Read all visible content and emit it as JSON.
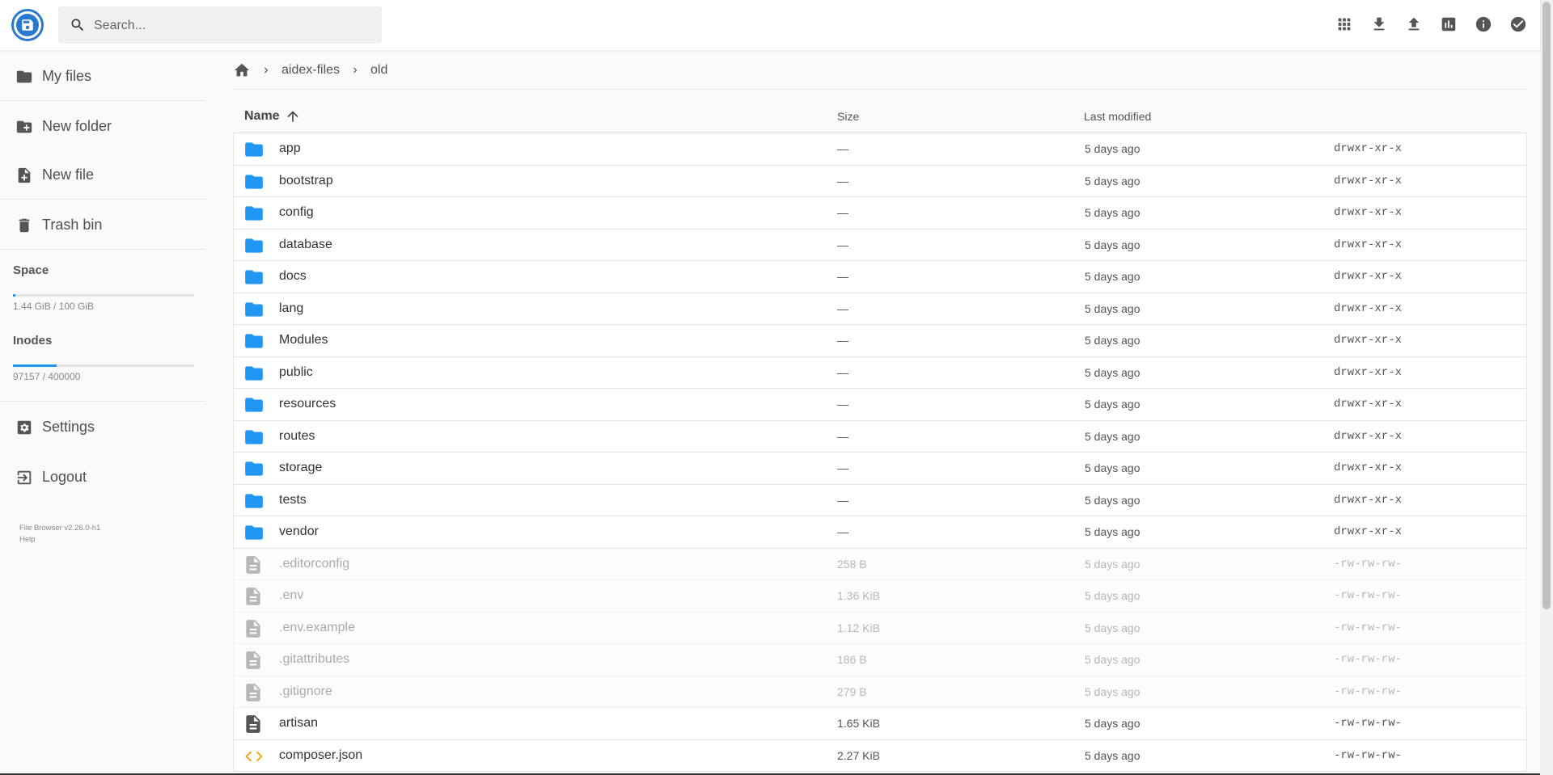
{
  "header": {
    "search_placeholder": "Search...",
    "actions": [
      "grid-view-icon",
      "download-icon",
      "upload-icon",
      "chart-icon",
      "info-icon",
      "select-check-icon"
    ]
  },
  "sidebar": {
    "items": [
      {
        "label": "My files",
        "icon": "folder-icon"
      },
      {
        "label": "New folder",
        "icon": "create-new-folder-icon"
      },
      {
        "label": "New file",
        "icon": "note-add-icon"
      },
      {
        "label": "Trash bin",
        "icon": "trash-icon"
      }
    ],
    "quota": {
      "space_title": "Space",
      "space_text": "1.44 GiB / 100 GiB",
      "space_fraction": 0.0144,
      "inodes_title": "Inodes",
      "inodes_text": "97157 / 400000",
      "inodes_fraction": 0.243
    },
    "settings_label": "Settings",
    "logout_label": "Logout",
    "credits_version": "File Browser v2.26.0-h1",
    "credits_help": "Help"
  },
  "breadcrumbs": [
    "aidex-files",
    "old"
  ],
  "list": {
    "col_name": "Name",
    "col_size": "Size",
    "col_modified": "Last modified",
    "rows": [
      {
        "name": "app",
        "size": "—",
        "modified": "5 days ago",
        "perm": "drwxr-xr-x",
        "type": "folder"
      },
      {
        "name": "bootstrap",
        "size": "—",
        "modified": "5 days ago",
        "perm": "drwxr-xr-x",
        "type": "folder"
      },
      {
        "name": "config",
        "size": "—",
        "modified": "5 days ago",
        "perm": "drwxr-xr-x",
        "type": "folder"
      },
      {
        "name": "database",
        "size": "—",
        "modified": "5 days ago",
        "perm": "drwxr-xr-x",
        "type": "folder"
      },
      {
        "name": "docs",
        "size": "—",
        "modified": "5 days ago",
        "perm": "drwxr-xr-x",
        "type": "folder"
      },
      {
        "name": "lang",
        "size": "—",
        "modified": "5 days ago",
        "perm": "drwxr-xr-x",
        "type": "folder"
      },
      {
        "name": "Modules",
        "size": "—",
        "modified": "5 days ago",
        "perm": "drwxr-xr-x",
        "type": "folder"
      },
      {
        "name": "public",
        "size": "—",
        "modified": "5 days ago",
        "perm": "drwxr-xr-x",
        "type": "folder"
      },
      {
        "name": "resources",
        "size": "—",
        "modified": "5 days ago",
        "perm": "drwxr-xr-x",
        "type": "folder"
      },
      {
        "name": "routes",
        "size": "—",
        "modified": "5 days ago",
        "perm": "drwxr-xr-x",
        "type": "folder"
      },
      {
        "name": "storage",
        "size": "—",
        "modified": "5 days ago",
        "perm": "drwxr-xr-x",
        "type": "folder"
      },
      {
        "name": "tests",
        "size": "—",
        "modified": "5 days ago",
        "perm": "drwxr-xr-x",
        "type": "folder"
      },
      {
        "name": "vendor",
        "size": "—",
        "modified": "5 days ago",
        "perm": "drwxr-xr-x",
        "type": "folder"
      },
      {
        "name": ".editorconfig",
        "size": "258 B",
        "modified": "5 days ago",
        "perm": "-rw-rw-rw-",
        "type": "hidden-file"
      },
      {
        "name": ".env",
        "size": "1.36 KiB",
        "modified": "5 days ago",
        "perm": "-rw-rw-rw-",
        "type": "hidden-file"
      },
      {
        "name": ".env.example",
        "size": "1.12 KiB",
        "modified": "5 days ago",
        "perm": "-rw-rw-rw-",
        "type": "hidden-file"
      },
      {
        "name": ".gitattributes",
        "size": "186 B",
        "modified": "5 days ago",
        "perm": "-rw-rw-rw-",
        "type": "hidden-file"
      },
      {
        "name": ".gitignore",
        "size": "279 B",
        "modified": "5 days ago",
        "perm": "-rw-rw-rw-",
        "type": "hidden-file"
      },
      {
        "name": "artisan",
        "size": "1.65 KiB",
        "modified": "5 days ago",
        "perm": "-rw-rw-rw-",
        "type": "file"
      },
      {
        "name": "composer.json",
        "size": "2.27 KiB",
        "modified": "5 days ago",
        "perm": "-rw-rw-rw-",
        "type": "code"
      }
    ]
  },
  "colors": {
    "accent": "#2196f3",
    "brand": "#2979d1",
    "code_icon": "#f0a830"
  }
}
